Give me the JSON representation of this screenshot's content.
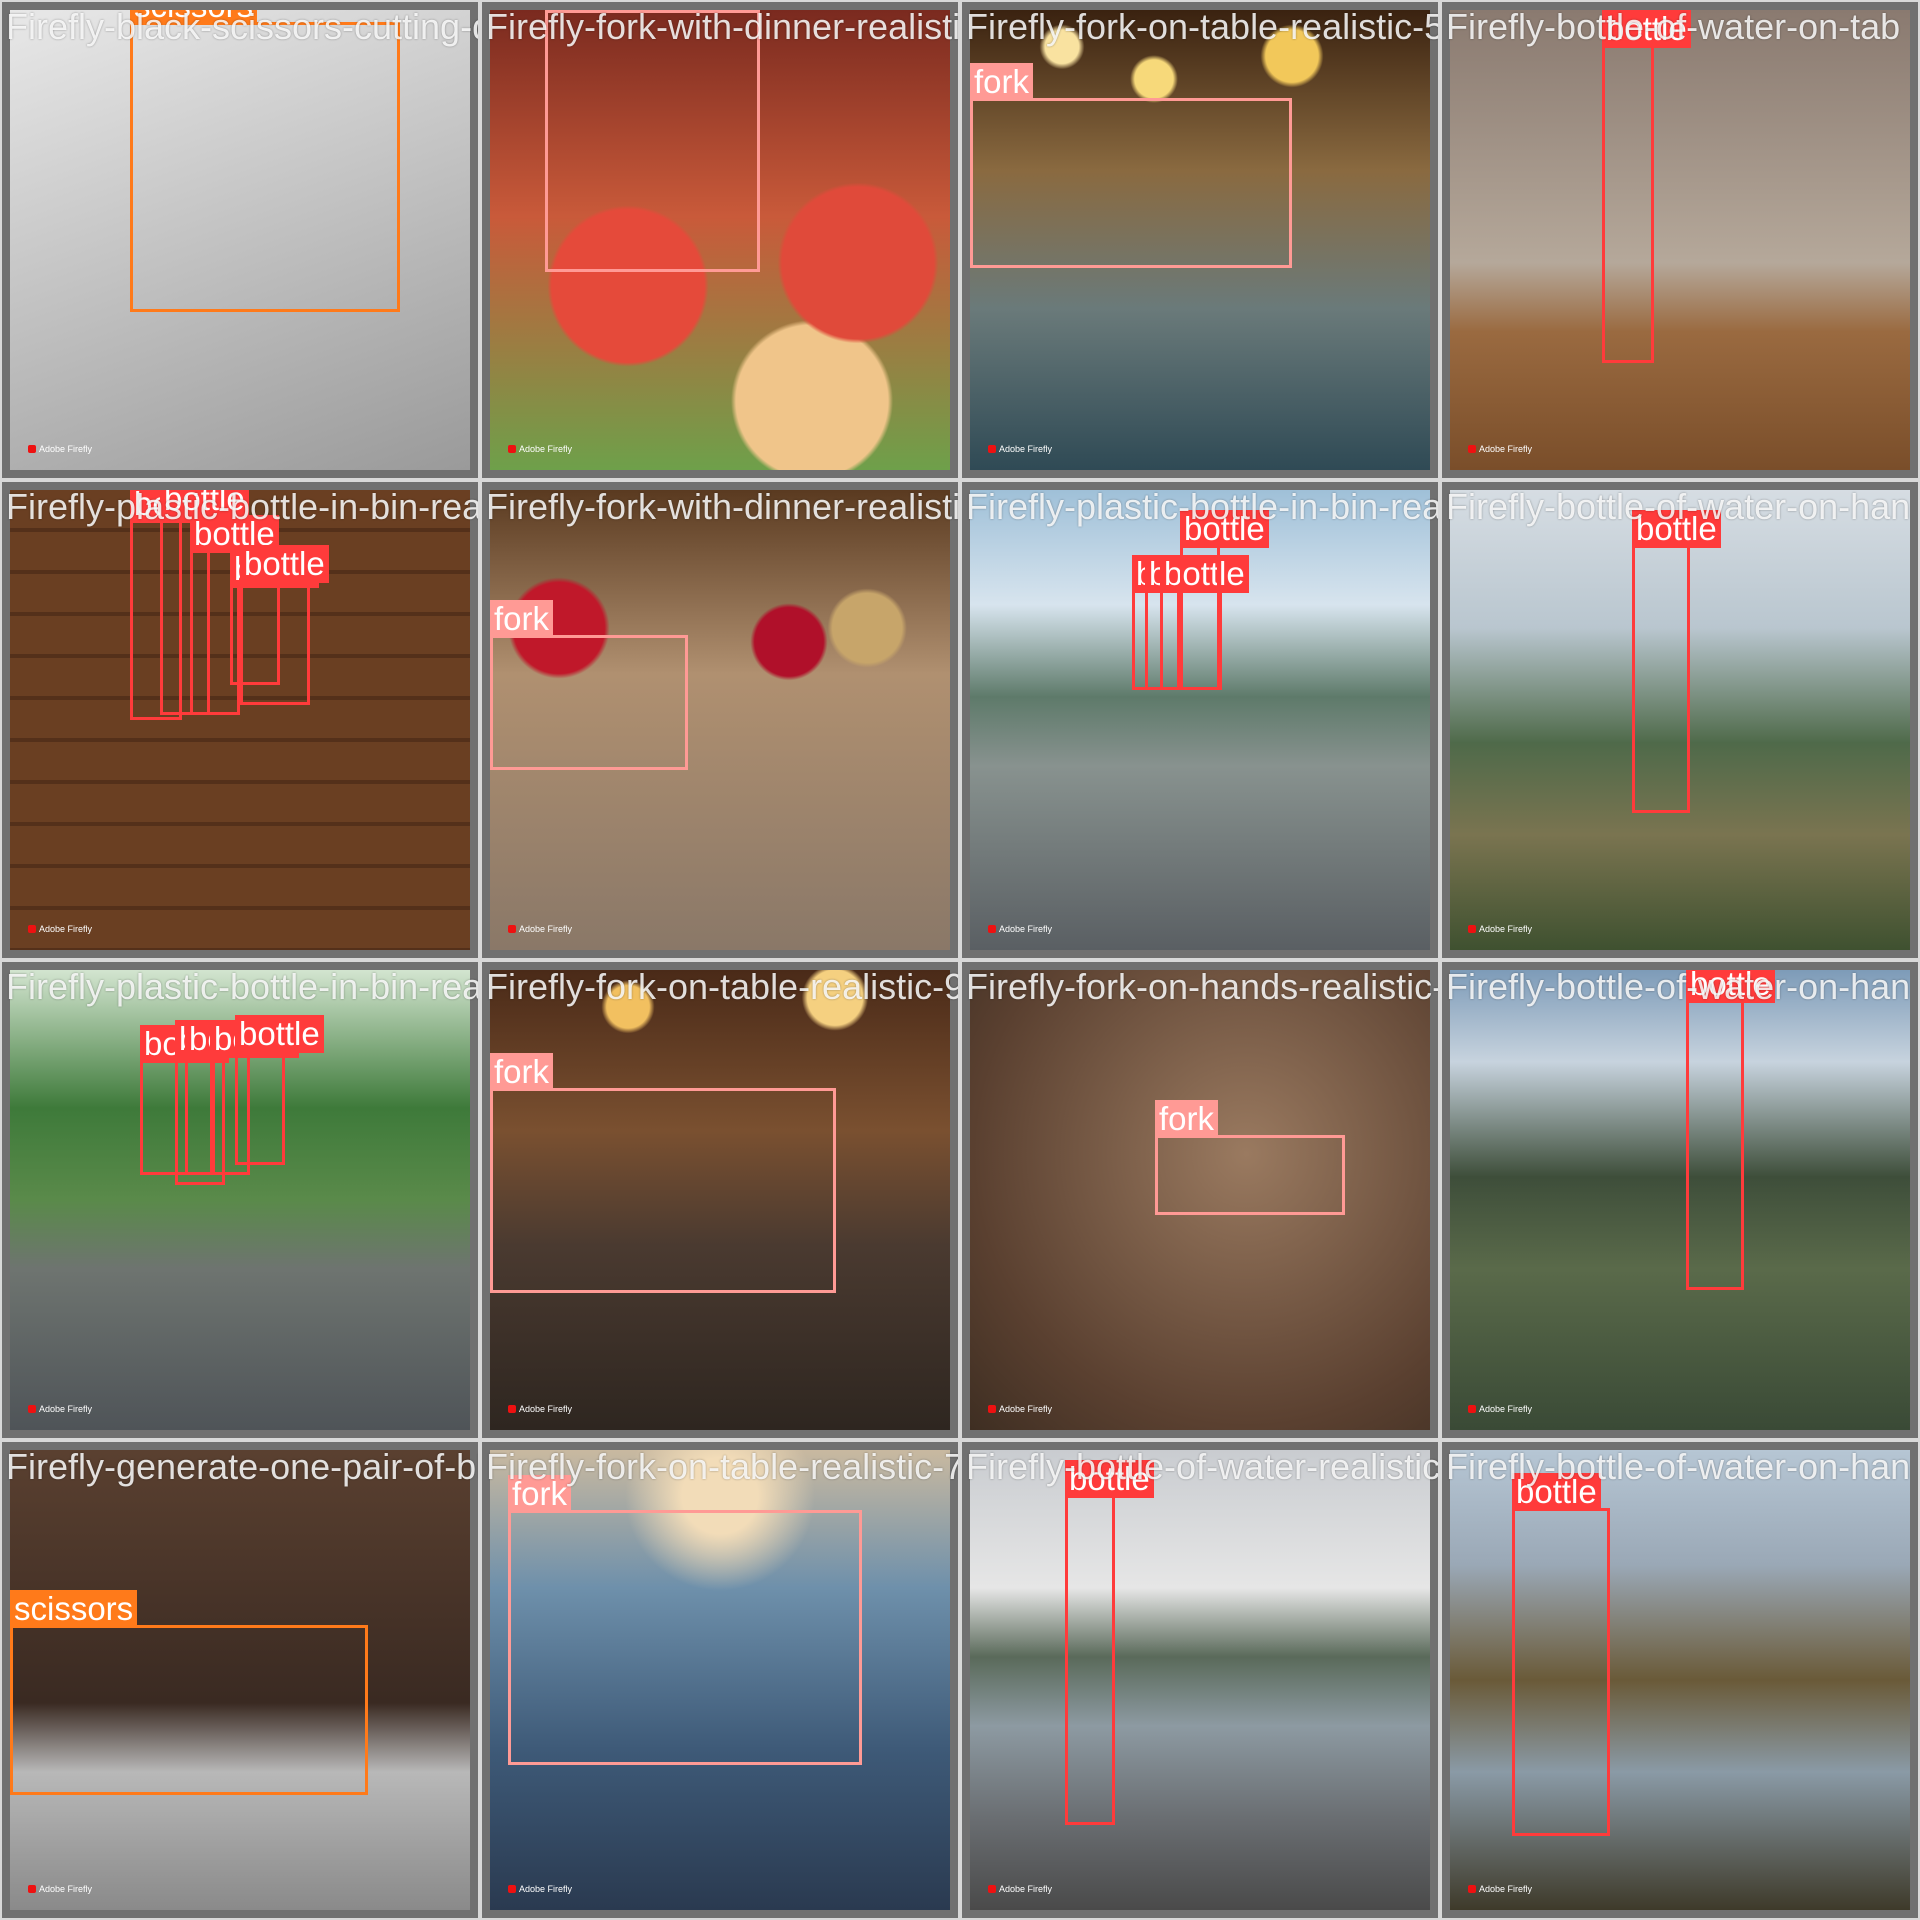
{
  "watermark": "Adobe Firefly",
  "colors": {
    "bottle": "#ff3b3b",
    "fork": "#ff9a95",
    "scissors": "#ff7a1a"
  },
  "tiles": [
    {
      "filename": "Firefly-black-scissors-cutting-diff",
      "scene": "studio",
      "detections": [
        {
          "label": "scissors"
        }
      ]
    },
    {
      "filename": "Firefly-fork-with-dinner-realistic-55675",
      "scene": "salad",
      "detections": [
        {
          "label": "fork"
        }
      ]
    },
    {
      "filename": "Firefly-fork-on-table-realistic-58210.jpg",
      "scene": "bokeh-gold",
      "detections": [
        {
          "label": "fork"
        }
      ]
    },
    {
      "filename": "Firefly-bottle-of-water-on-tab",
      "scene": "wood-plant",
      "detections": [
        {
          "label": "bottle"
        }
      ]
    },
    {
      "filename": "Firefly-plastic-bottle-in-bin-realistic",
      "scene": "woodwall",
      "detections": [
        {
          "label": "bottle"
        },
        {
          "label": "bottle"
        },
        {
          "label": "bottle"
        },
        {
          "label": "bottle"
        },
        {
          "label": "bottle"
        }
      ]
    },
    {
      "filename": "Firefly-fork-with-dinner-realistic-2249",
      "scene": "xmas",
      "detections": [
        {
          "label": "fork"
        }
      ]
    },
    {
      "filename": "Firefly-plastic-bottle-in-bin-realistic",
      "scene": "mountain-road",
      "detections": [
        {
          "label": "bottle"
        },
        {
          "label": "bottle"
        },
        {
          "label": "bottle"
        },
        {
          "label": "bottle"
        }
      ]
    },
    {
      "filename": "Firefly-bottle-of-water-on-han",
      "scene": "clouds-hills",
      "detections": [
        {
          "label": "bottle"
        }
      ]
    },
    {
      "filename": "Firefly-plastic-bottle-in-bin-realistic",
      "scene": "forest-road",
      "detections": [
        {
          "label": "bottle"
        },
        {
          "label": "bottle"
        },
        {
          "label": "bottle"
        },
        {
          "label": "bottle"
        },
        {
          "label": "bottle"
        }
      ]
    },
    {
      "filename": "Firefly-fork-on-table-realistic-93675.jpg",
      "scene": "bokeh-brown",
      "detections": [
        {
          "label": "fork"
        }
      ]
    },
    {
      "filename": "Firefly-fork-on-hands-realistic-89783.jpg",
      "scene": "brown-studio",
      "detections": [
        {
          "label": "fork"
        }
      ]
    },
    {
      "filename": "Firefly-bottle-of-water-on-han",
      "scene": "lake-mountains",
      "detections": [
        {
          "label": "bottle"
        }
      ]
    },
    {
      "filename": "Firefly-generate-one-pair-of-blue-han",
      "scene": "laptop",
      "detections": [
        {
          "label": "scissors"
        }
      ]
    },
    {
      "filename": "Firefly-fork-on-table-realistic-70e8",
      "scene": "blue-table",
      "detections": [
        {
          "label": "fork"
        }
      ]
    },
    {
      "filename": "Firefly-bottle-of-water-realistic-8270",
      "scene": "lake-wood",
      "detections": [
        {
          "label": "bottle"
        }
      ]
    },
    {
      "filename": "Firefly-bottle-of-water-on-han",
      "scene": "autumn-lake",
      "detections": [
        {
          "label": "bottle"
        }
      ]
    }
  ]
}
